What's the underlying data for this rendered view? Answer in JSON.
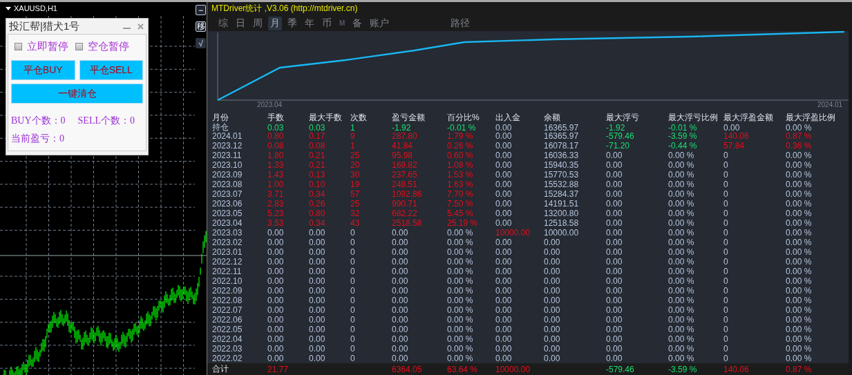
{
  "chart_window": {
    "symbol": "XAUUSD,H1",
    "side_buttons": [
      "−",
      "移",
      "√"
    ]
  },
  "panel": {
    "title": "投汇帮|猎犬1号",
    "checks": [
      {
        "label": "立即暂停",
        "checked": false
      },
      {
        "label": "空仓暂停",
        "checked": false
      }
    ],
    "buttons": [
      {
        "label": "平仓BUY"
      },
      {
        "label": "平仓SELL"
      },
      {
        "label": "一键清仓"
      }
    ],
    "stats": [
      "BUY个数：0",
      "SELL个数：0",
      "当前盈亏：0"
    ]
  },
  "stats_window": {
    "title": "MTDriver统计 ,V3.06 (http://mtdriver.cn)",
    "tabs": [
      {
        "label": "综",
        "selected": false,
        "disabled": false
      },
      {
        "label": "日",
        "selected": false,
        "disabled": false
      },
      {
        "label": "周",
        "selected": false,
        "disabled": false
      },
      {
        "label": "月",
        "selected": true,
        "disabled": false
      },
      {
        "label": "季",
        "selected": false,
        "disabled": false
      },
      {
        "label": "年",
        "selected": false,
        "disabled": false
      },
      {
        "label": "币",
        "selected": false,
        "disabled": false
      },
      {
        "label": "M",
        "selected": false,
        "disabled": true
      },
      {
        "label": "备",
        "selected": false,
        "disabled": false
      },
      {
        "label": "账户",
        "selected": false,
        "disabled": false
      }
    ],
    "side_tabs": [
      {
        "label": "路径",
        "selected": false,
        "disabled": false
      }
    ],
    "equity_chart": {
      "x_labels": [
        "2023.04",
        "2024.01"
      ]
    },
    "table": {
      "columns": [
        "月份",
        "手数",
        "最大手数",
        "次数",
        "盈亏金额",
        "百分比%",
        "出入金",
        "余额",
        "最大浮亏",
        "最大浮亏比例",
        "最大浮盈金额",
        "最大浮盈比例"
      ],
      "rows": [
        {
          "cells": [
            "持仓",
            {
              "text": "0.03",
              "color": "#18e070"
            },
            {
              "text": "0.03",
              "color": "#18e070"
            },
            {
              "text": "1",
              "color": "#18e070"
            },
            {
              "text": "-1.92",
              "color": "#18e070"
            },
            {
              "text": "-0.01 %",
              "color": "#18e070"
            },
            "0.00",
            "16365.97",
            {
              "text": "-1.92",
              "color": "#18e070"
            },
            {
              "text": "-0.01 %",
              "color": "#18e070"
            },
            "0.00",
            "0.00 %"
          ]
        },
        {
          "cells": [
            "2024.01",
            {
              "text": "0.80",
              "color": "#e0101c"
            },
            {
              "text": "0.17",
              "color": "#e0101c"
            },
            {
              "text": "9",
              "color": "#e0101c"
            },
            {
              "text": "287.80",
              "color": "#e0101c"
            },
            {
              "text": "1.79 %",
              "color": "#e0101c"
            },
            "0.00",
            "16365.97",
            {
              "text": "-579.46",
              "color": "#18e070"
            },
            {
              "text": "-3.59 %",
              "color": "#18e070"
            },
            {
              "text": "140.06",
              "color": "#e0101c"
            },
            {
              "text": "0.87 %",
              "color": "#e0101c"
            }
          ]
        },
        {
          "cells": [
            "2023.12",
            {
              "text": "0.08",
              "color": "#e0101c"
            },
            {
              "text": "0.08",
              "color": "#e0101c"
            },
            {
              "text": "1",
              "color": "#e0101c"
            },
            {
              "text": "41.84",
              "color": "#e0101c"
            },
            {
              "text": "0.26 %",
              "color": "#e0101c"
            },
            "0.00",
            "16078.17",
            {
              "text": "-71.20",
              "color": "#18e070"
            },
            {
              "text": "-0.44 %",
              "color": "#18e070"
            },
            {
              "text": "57.84",
              "color": "#e0101c"
            },
            {
              "text": "0.36 %",
              "color": "#e0101c"
            }
          ]
        },
        {
          "cells": [
            "2023.11",
            {
              "text": "1.80",
              "color": "#e0101c"
            },
            {
              "text": "0.21",
              "color": "#e0101c"
            },
            {
              "text": "25",
              "color": "#e0101c"
            },
            {
              "text": "95.98",
              "color": "#e0101c"
            },
            {
              "text": "0.60 %",
              "color": "#e0101c"
            },
            "0.00",
            "16036.33",
            "0.00",
            "0.00 %",
            "0",
            "0.00 %"
          ]
        },
        {
          "cells": [
            "2023.10",
            {
              "text": "1.33",
              "color": "#e0101c"
            },
            {
              "text": "0.21",
              "color": "#e0101c"
            },
            {
              "text": "20",
              "color": "#e0101c"
            },
            {
              "text": "169.82",
              "color": "#e0101c"
            },
            {
              "text": "1.08 %",
              "color": "#e0101c"
            },
            "0.00",
            "15940.35",
            "0.00",
            "0.00 %",
            "0",
            "0.00 %"
          ]
        },
        {
          "cells": [
            "2023.09",
            {
              "text": "1.43",
              "color": "#e0101c"
            },
            {
              "text": "0.13",
              "color": "#e0101c"
            },
            {
              "text": "30",
              "color": "#e0101c"
            },
            {
              "text": "237.65",
              "color": "#e0101c"
            },
            {
              "text": "1.53 %",
              "color": "#e0101c"
            },
            "0.00",
            "15770.53",
            "0.00",
            "0.00 %",
            "0",
            "0.00 %"
          ]
        },
        {
          "cells": [
            "2023.08",
            {
              "text": "1.00",
              "color": "#e0101c"
            },
            {
              "text": "0.10",
              "color": "#e0101c"
            },
            {
              "text": "19",
              "color": "#e0101c"
            },
            {
              "text": "248.51",
              "color": "#e0101c"
            },
            {
              "text": "1.63 %",
              "color": "#e0101c"
            },
            "0.00",
            "15532.88",
            "0.00",
            "0.00 %",
            "0",
            "0.00 %"
          ]
        },
        {
          "cells": [
            "2023.07",
            {
              "text": "3.71",
              "color": "#e0101c"
            },
            {
              "text": "0.34",
              "color": "#e0101c"
            },
            {
              "text": "57",
              "color": "#e0101c"
            },
            {
              "text": "1092.86",
              "color": "#e0101c"
            },
            {
              "text": "7.70 %",
              "color": "#e0101c"
            },
            "0.00",
            "15284.37",
            "0.00",
            "0.00 %",
            "0",
            "0.00 %"
          ]
        },
        {
          "cells": [
            "2023.06",
            {
              "text": "2.83",
              "color": "#e0101c"
            },
            {
              "text": "0.26",
              "color": "#e0101c"
            },
            {
              "text": "25",
              "color": "#e0101c"
            },
            {
              "text": "990.71",
              "color": "#e0101c"
            },
            {
              "text": "7.50 %",
              "color": "#e0101c"
            },
            "0.00",
            "14191.51",
            "0.00",
            "0.00 %",
            "0",
            "0.00 %"
          ]
        },
        {
          "cells": [
            "2023.05",
            {
              "text": "5.23",
              "color": "#e0101c"
            },
            {
              "text": "0.80",
              "color": "#e0101c"
            },
            {
              "text": "32",
              "color": "#e0101c"
            },
            {
              "text": "682.22",
              "color": "#e0101c"
            },
            {
              "text": "5.45 %",
              "color": "#e0101c"
            },
            "0.00",
            "13200.80",
            "0.00",
            "0.00 %",
            "0",
            "0.00 %"
          ]
        },
        {
          "cells": [
            "2023.04",
            {
              "text": "3.53",
              "color": "#e0101c"
            },
            {
              "text": "0.34",
              "color": "#e0101c"
            },
            {
              "text": "43",
              "color": "#e0101c"
            },
            {
              "text": "2518.58",
              "color": "#e0101c"
            },
            {
              "text": "25.19 %",
              "color": "#e0101c"
            },
            "0.00",
            "12518.58",
            "0.00",
            "0.00 %",
            "0",
            "0.00 %"
          ]
        },
        {
          "cells": [
            "2023.03",
            "0.00",
            "0.00",
            "0",
            "0.00",
            "0.00 %",
            {
              "text": "10000.00",
              "color": "#e0101c"
            },
            "10000.00",
            "0.00",
            "0.00 %",
            "0",
            "0.00 %"
          ]
        },
        {
          "cells": [
            "2023.02",
            "0.00",
            "0.00",
            "0",
            "0.00",
            "0.00 %",
            "0.00",
            "0.00",
            "0.00",
            "0.00 %",
            "0",
            "0.00 %"
          ]
        },
        {
          "cells": [
            "2023.01",
            "0.00",
            "0.00",
            "0",
            "0.00",
            "0.00 %",
            "0.00",
            "0.00",
            "0.00",
            "0.00 %",
            "0",
            "0.00 %"
          ]
        },
        {
          "cells": [
            "2022.12",
            "0.00",
            "0.00",
            "0",
            "0.00",
            "0.00 %",
            "0.00",
            "0.00",
            "0.00",
            "0.00 %",
            "0",
            "0.00 %"
          ]
        },
        {
          "cells": [
            "2022.11",
            "0.00",
            "0.00",
            "0",
            "0.00",
            "0.00 %",
            "0.00",
            "0.00",
            "0.00",
            "0.00 %",
            "0",
            "0.00 %"
          ]
        },
        {
          "cells": [
            "2022.10",
            "0.00",
            "0.00",
            "0",
            "0.00",
            "0.00 %",
            "0.00",
            "0.00",
            "0.00",
            "0.00 %",
            "0",
            "0.00 %"
          ]
        },
        {
          "cells": [
            "2022.09",
            "0.00",
            "0.00",
            "0",
            "0.00",
            "0.00 %",
            "0.00",
            "0.00",
            "0.00",
            "0.00 %",
            "0",
            "0.00 %"
          ]
        },
        {
          "cells": [
            "2022.08",
            "0.00",
            "0.00",
            "0",
            "0.00",
            "0.00 %",
            "0.00",
            "0.00",
            "0.00",
            "0.00 %",
            "0",
            "0.00 %"
          ]
        },
        {
          "cells": [
            "2022.07",
            "0.00",
            "0.00",
            "0",
            "0.00",
            "0.00 %",
            "0.00",
            "0.00",
            "0.00",
            "0.00 %",
            "0",
            "0.00 %"
          ]
        },
        {
          "cells": [
            "2022.06",
            "0.00",
            "0.00",
            "0",
            "0.00",
            "0.00 %",
            "0.00",
            "0.00",
            "0.00",
            "0.00 %",
            "0",
            "0.00 %"
          ]
        },
        {
          "cells": [
            "2022.05",
            "0.00",
            "0.00",
            "0",
            "0.00",
            "0.00 %",
            "0.00",
            "0.00",
            "0.00",
            "0.00 %",
            "0",
            "0.00 %"
          ]
        },
        {
          "cells": [
            "2022.04",
            "0.00",
            "0.00",
            "0",
            "0.00",
            "0.00 %",
            "0.00",
            "0.00",
            "0.00",
            "0.00 %",
            "0",
            "0.00 %"
          ]
        },
        {
          "cells": [
            "2022.03",
            "0.00",
            "0.00",
            "0",
            "0.00",
            "0.00 %",
            "0.00",
            "0.00",
            "0.00",
            "0.00 %",
            "0",
            "0.00 %"
          ]
        },
        {
          "cells": [
            "2022.02",
            "0.00",
            "0.00",
            "0",
            "0.00",
            "0.00 %",
            "0.00",
            "0.00",
            "0.00",
            "0.00 %",
            "0",
            "0.00 %"
          ]
        }
      ],
      "total": {
        "cells": [
          "合计",
          {
            "text": "21.77",
            "color": "#e0101c"
          },
          null,
          null,
          {
            "text": "6364.05",
            "color": "#e0101c"
          },
          {
            "text": "63.64 %",
            "color": "#e0101c"
          },
          {
            "text": "10000.00",
            "color": "#e0101c"
          },
          null,
          {
            "text": "-579.46",
            "color": "#18e070"
          },
          {
            "text": "-3.59 %",
            "color": "#18e070"
          },
          {
            "text": "140.06",
            "color": "#e0101c"
          },
          {
            "text": "0.87 %",
            "color": "#e0101c"
          }
        ]
      }
    }
  }
}
